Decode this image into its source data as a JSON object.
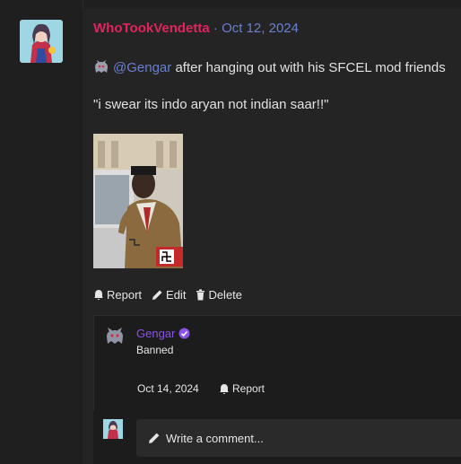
{
  "post": {
    "author": "WhoTookVendetta",
    "separator": "·",
    "date": "Oct 12, 2024",
    "mention": "@Gengar",
    "body_text": "after hanging out with his SFCEL mod friends",
    "quote": "\"i swear its indo aryan not indian saar!!\""
  },
  "actions": {
    "report": "Report",
    "edit": "Edit",
    "delete": "Delete"
  },
  "reply": {
    "author": "Gengar",
    "status": "Banned",
    "date": "Oct 14, 2024",
    "report": "Report"
  },
  "comment": {
    "placeholder": "Write a comment..."
  },
  "colors": {
    "author_name": "#e0245e",
    "link": "#6b7fcf",
    "reply_name": "#8a52e6",
    "background": "#1f1f1f",
    "card": "#242424"
  },
  "icons": [
    "ghost-icon",
    "bell-icon",
    "pencil-icon",
    "trash-icon",
    "verified-icon"
  ]
}
